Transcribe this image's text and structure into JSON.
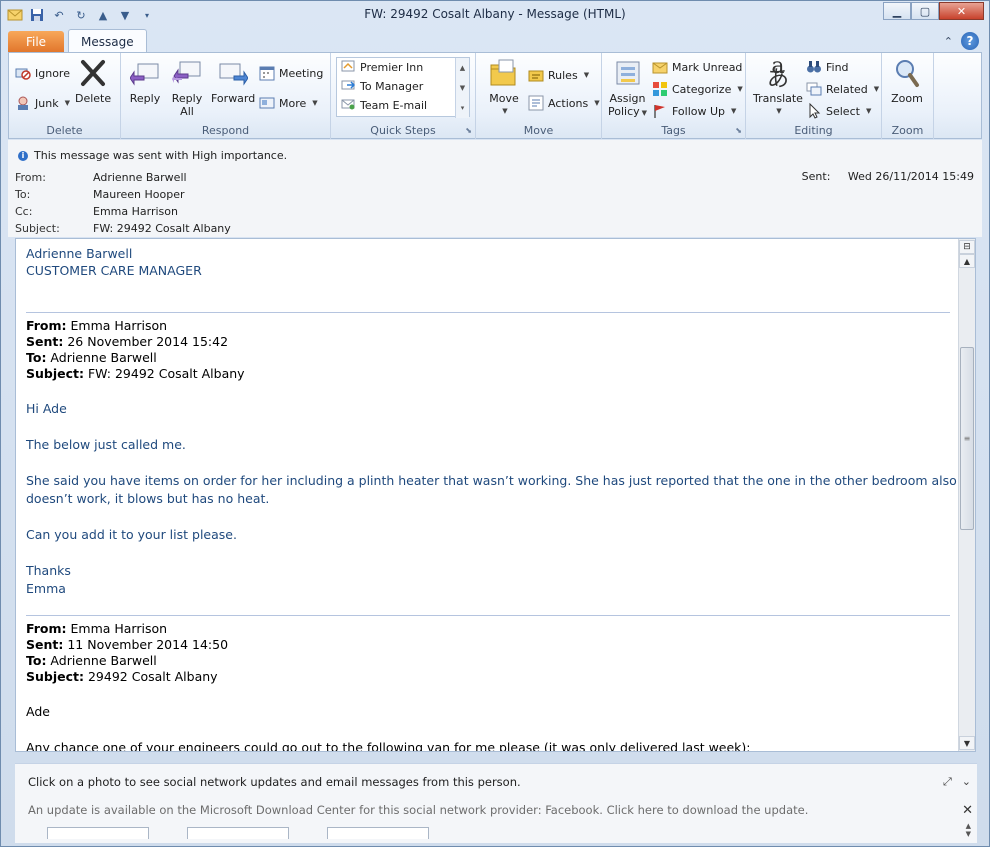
{
  "window": {
    "title": "FW: 29492 Cosalt Albany  -  Message (HTML)"
  },
  "tabs": {
    "file": "File",
    "message": "Message"
  },
  "ribbon": {
    "delete": {
      "label": "Delete",
      "ignore": "Ignore",
      "junk": "Junk",
      "delete_btn": "Delete"
    },
    "respond": {
      "label": "Respond",
      "reply": "Reply",
      "reply_all_1": "Reply",
      "reply_all_2": "All",
      "forward": "Forward",
      "meeting": "Meeting",
      "more": "More"
    },
    "quick_steps": {
      "label": "Quick Steps",
      "items": [
        "Premier Inn",
        "To Manager",
        "Team E-mail"
      ]
    },
    "move": {
      "label": "Move",
      "move_btn": "Move",
      "rules": "Rules",
      "actions": "Actions"
    },
    "tags": {
      "label": "Tags",
      "assign_1": "Assign",
      "assign_2": "Policy",
      "mark_unread": "Mark Unread",
      "categorize": "Categorize",
      "follow_up": "Follow Up"
    },
    "editing": {
      "label": "Editing",
      "translate": "Translate",
      "find": "Find",
      "related": "Related",
      "select": "Select"
    },
    "zoom": {
      "label": "Zoom",
      "zoom_btn": "Zoom"
    }
  },
  "header": {
    "importance": "This message was sent with High importance.",
    "from_label": "From:",
    "from": "Adrienne Barwell",
    "to_label": "To:",
    "to": "Maureen Hooper",
    "cc_label": "Cc:",
    "cc": "Emma Harrison",
    "subject_label": "Subject:",
    "subject": "FW: 29492 Cosalt Albany",
    "sent_label": "Sent:",
    "sent": "Wed 26/11/2014 15:49"
  },
  "body": {
    "signature_name": "Adrienne Barwell",
    "signature_title": "CUSTOMER CARE MANAGER",
    "fwd1": {
      "from_label": "From:",
      "from": " Emma Harrison",
      "sent_label": "Sent:",
      "sent": " 26 November 2014 15:42",
      "to_label": "To:",
      "to": " Adrienne Barwell",
      "subject_label": "Subject:",
      "subject": " FW: 29492 Cosalt Albany"
    },
    "greeting1": "Hi Ade",
    "para1": "The below just called me.",
    "para2a": "She said you have items on order for her including a plinth heater that wasn’t working.  She has just reported that the one in the other bedroom also",
    "para2b": "doesn’t work, it blows but has no heat.",
    "para3": "Can you add it to your list please.",
    "thanks": "Thanks",
    "sign_emma": "Emma",
    "fwd2": {
      "from_label": "From:",
      "from": " Emma Harrison",
      "sent_label": "Sent:",
      "sent": " 11 November 2014 14:50",
      "to_label": "To:",
      "to": " Adrienne Barwell",
      "subject_label": "Subject:",
      "subject": " 29492 Cosalt Albany"
    },
    "greeting2": "Ade",
    "para4": "Any chance one of your engineers could go out to the following van for me please (it was only delivered last week):"
  },
  "people_pane": {
    "prompt": "Click on a photo to see social network updates and email messages from this person.",
    "update": "An update is available on the Microsoft Download Center for this social network provider: Facebook. Click here to download the update."
  },
  "icons": {
    "mail": "mail-icon",
    "save": "save-icon",
    "undo": "undo-icon",
    "redo": "redo-icon"
  },
  "colors": {
    "file_tab": "#e0742a",
    "body_text": "#1f497d",
    "separator": "#b5c4df"
  }
}
